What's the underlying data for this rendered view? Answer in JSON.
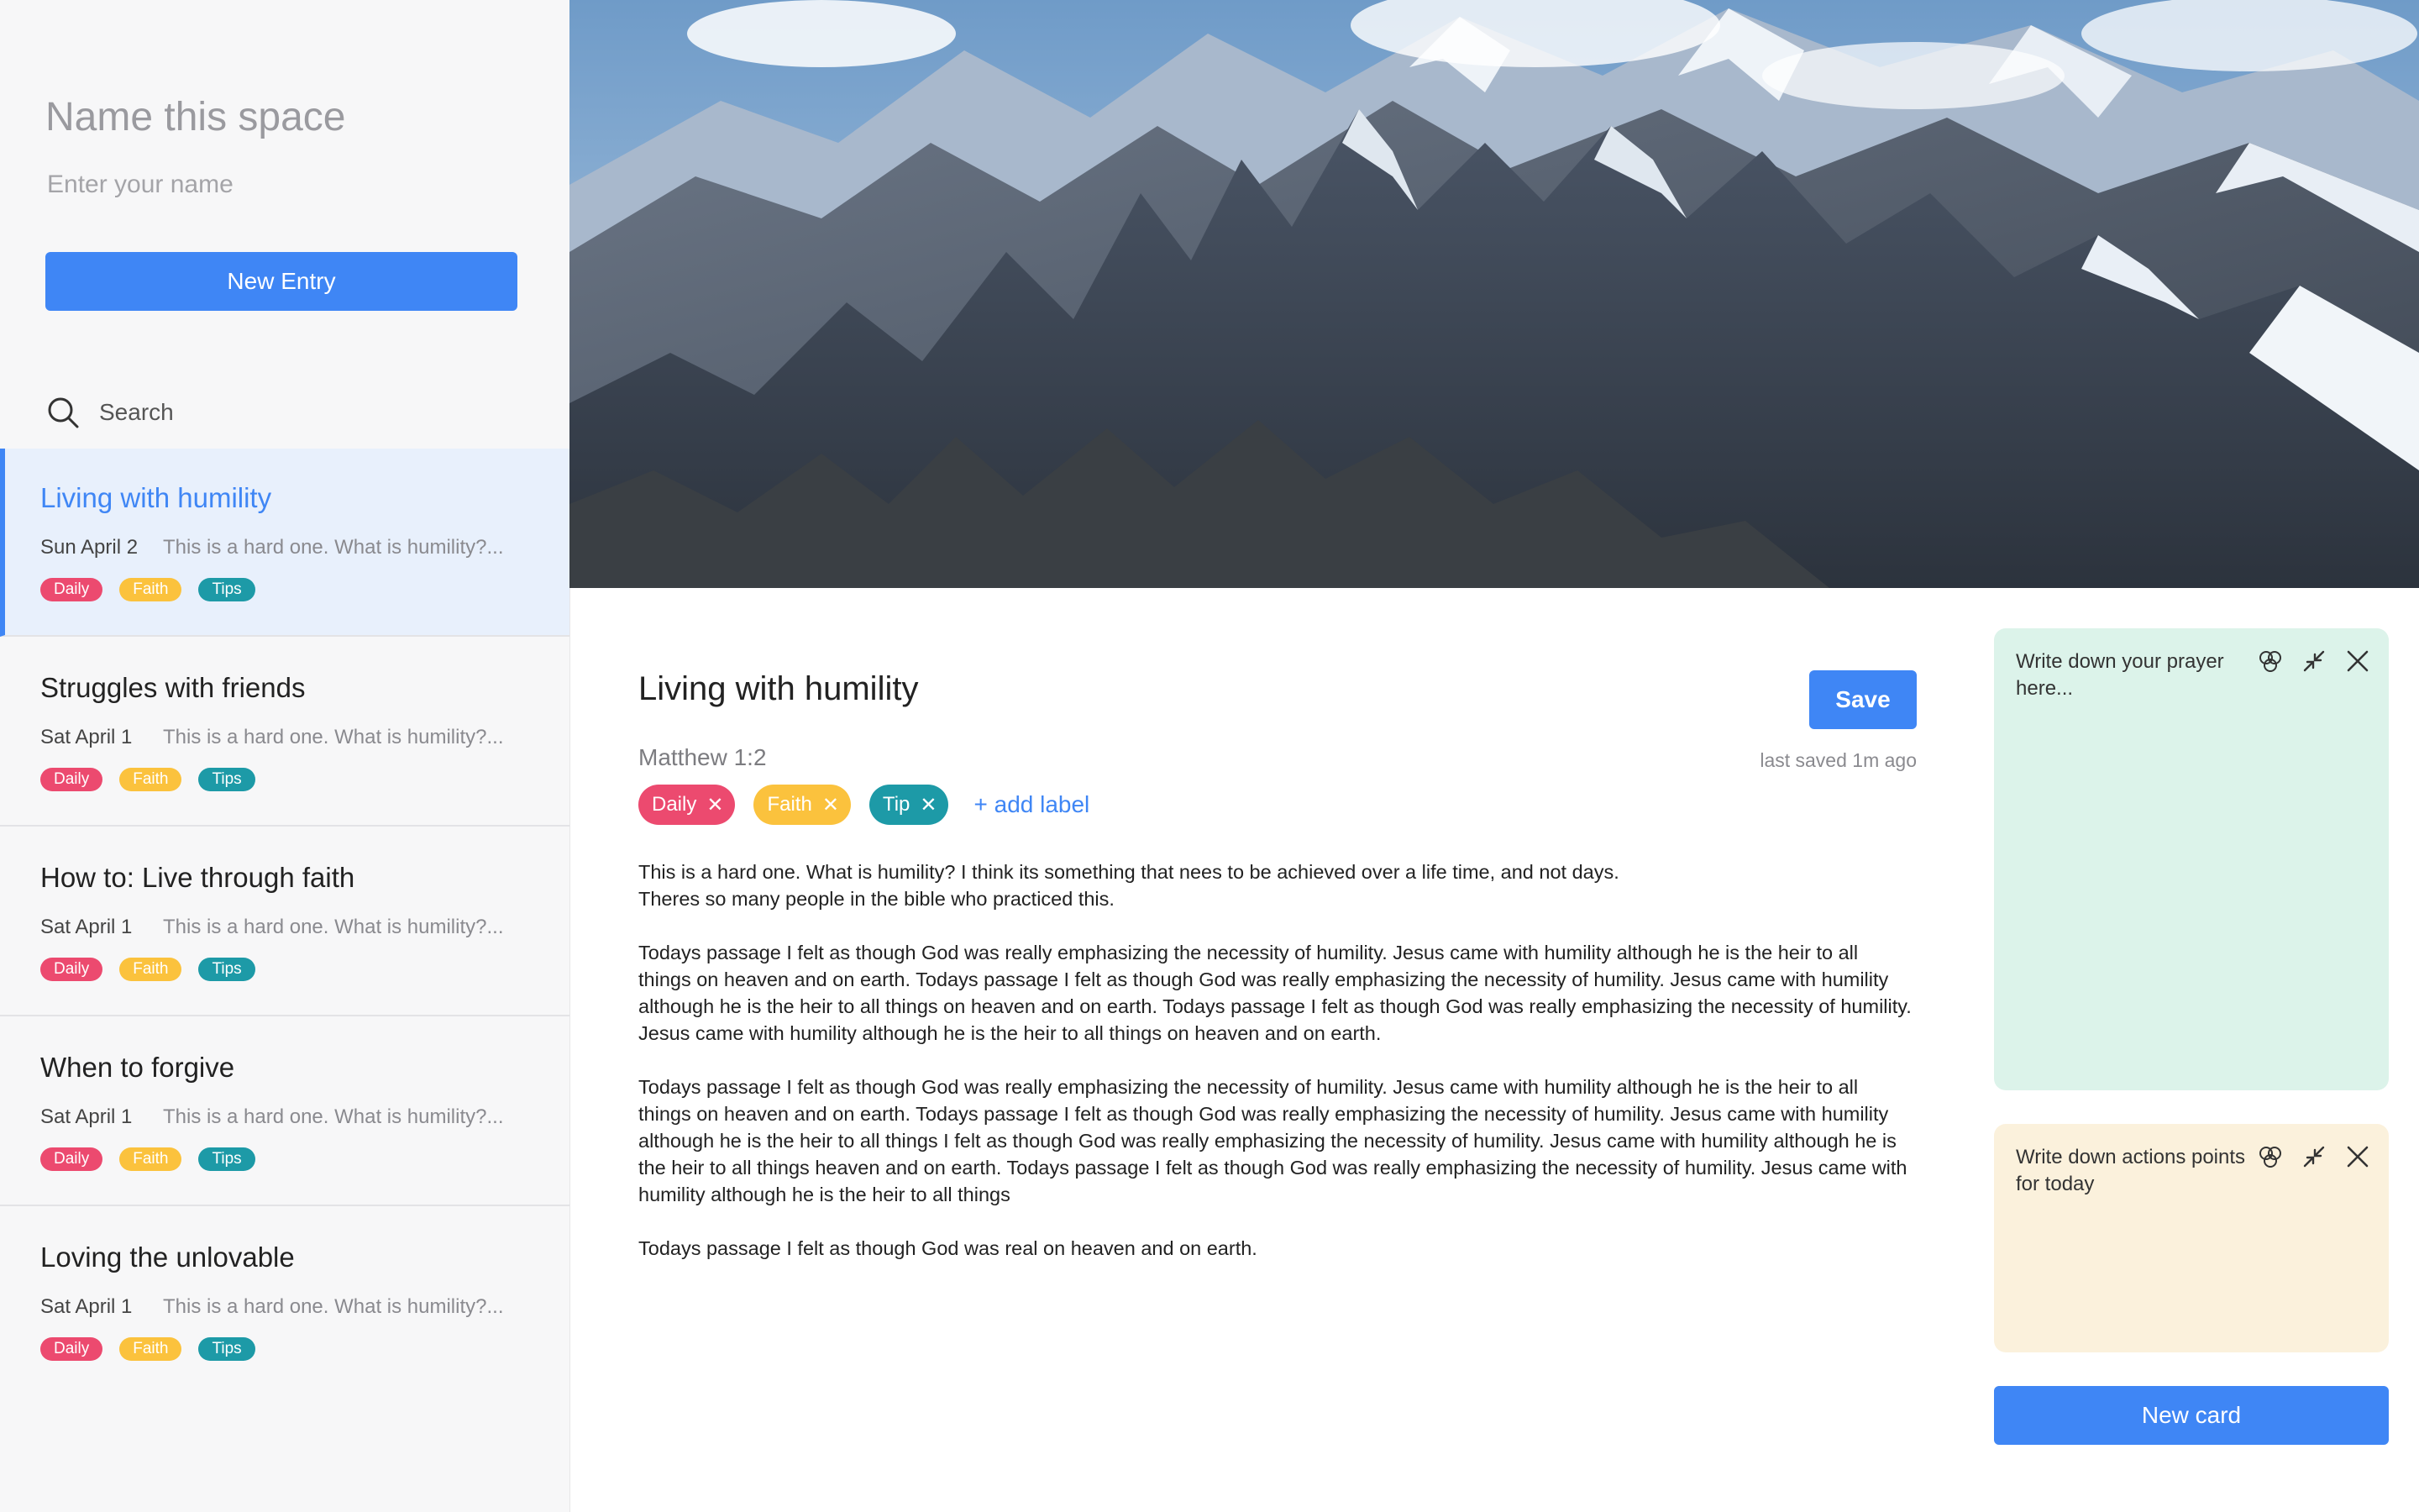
{
  "sidebar": {
    "space_title": "Name this space",
    "name_placeholder": "Enter your name",
    "new_entry_label": "New Entry",
    "search_label": "Search",
    "entries": [
      {
        "title": "Living with humility",
        "date": "Sun April 2",
        "snippet": "This is a hard one. What is humility?...",
        "tags": [
          "Daily",
          "Faith",
          "Tips"
        ]
      },
      {
        "title": "Struggles with friends",
        "date": "Sat April 1",
        "snippet": "This is a hard one. What is humility?...",
        "tags": [
          "Daily",
          "Faith",
          "Tips"
        ]
      },
      {
        "title": "How to: Live through faith",
        "date": "Sat April 1",
        "snippet": "This is a hard one. What is humility?...",
        "tags": [
          "Daily",
          "Faith",
          "Tips"
        ]
      },
      {
        "title": "When to forgive",
        "date": "Sat April 1",
        "snippet": "This is a hard one. What is humility?...",
        "tags": [
          "Daily",
          "Faith",
          "Tips"
        ]
      },
      {
        "title": "Loving the unlovable",
        "date": "Sat April 1",
        "snippet": "This is a hard one. What is humility?...",
        "tags": [
          "Daily",
          "Faith",
          "Tips"
        ]
      }
    ]
  },
  "editor": {
    "title": "Living with humility",
    "save_label": "Save",
    "verse": "Matthew 1:2",
    "last_saved": "last saved 1m ago",
    "labels": [
      "Daily",
      "Faith",
      "Tip"
    ],
    "add_label": "+ add label",
    "remove_glyph": "✕",
    "paragraphs": [
      "This is a hard one. What is humility? I think its something that nees to be achieved over a life time, and not days.\nTheres so many people in the bible who practiced this.",
      "Todays passage I felt as though God was really emphasizing the necessity of humility. Jesus came with humility although he is the heir to all things on heaven and on earth. Todays passage I felt as though God was really emphasizing the necessity of humility. Jesus came with humility although he is the heir to all things on heaven and on earth. Todays passage I felt as though God was really emphasizing the necessity of humility. Jesus came with humility although he is the heir to all things on heaven and on earth.",
      "Todays passage I felt as though God was really emphasizing the necessity of humility. Jesus came with humility although he is the heir to all things on heaven and on earth. Todays passage I felt as though God was really emphasizing the necessity of humility. Jesus came with humility although he is the heir to all things I felt as though God was really emphasizing the necessity of humility. Jesus came with humility although he is the heir to all things heaven and on earth. Todays passage I felt as though God was really emphasizing the necessity of humility. Jesus came with humility although he is the heir to all things",
      "Todays passage I felt as though God was real on heaven and on earth."
    ]
  },
  "cards": [
    {
      "text": "Write down your prayer here...",
      "color": "#dcf3ea"
    },
    {
      "text": "Write down actions points for today",
      "color": "#fbf1dc"
    }
  ],
  "new_card_label": "New card",
  "colors": {
    "accent": "#3f86f5",
    "tag_daily": "#ec4a6f",
    "tag_faith": "#fbc23d",
    "tag_tips": "#1d9aa7",
    "active_entry_bg": "#e8f0fc"
  },
  "icons": [
    "search-icon",
    "palette-icon",
    "minimize-icon",
    "close-icon",
    "remove-label-icon"
  ]
}
